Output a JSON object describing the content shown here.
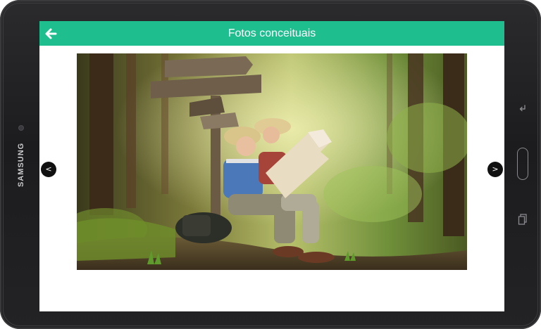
{
  "device": {
    "brand": "SAMSUNG",
    "icons": {
      "back": "back-key-icon",
      "home": "home-key",
      "recent": "recent-apps-icon"
    }
  },
  "app_bar": {
    "title": "Fotos conceituais",
    "back_icon": "arrow-left-icon",
    "color": "#1ebe8f"
  },
  "gallery": {
    "prev_label": "<",
    "next_label": ">"
  }
}
